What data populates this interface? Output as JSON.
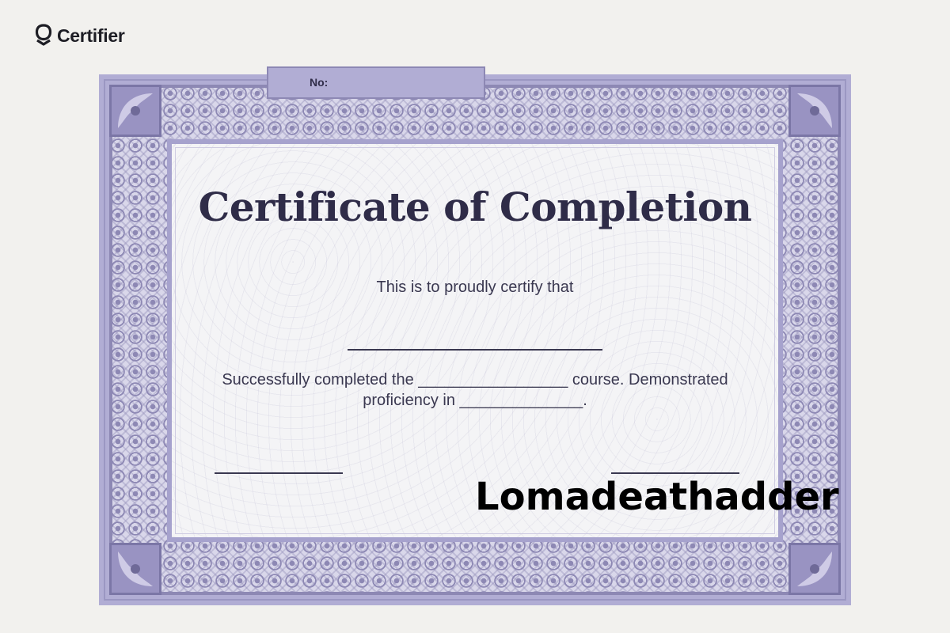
{
  "brand": {
    "name": "Certifier",
    "icon": "shield-check-icon"
  },
  "certificate": {
    "number_label": "No:",
    "title": "Certificate of Completion",
    "intro": "This is to proudly certify that",
    "body_line1": "Successfully completed the _________________ course. Demonstrated",
    "body_line2": "proficiency in ______________."
  },
  "overlay_text": "Lomadeathadder",
  "colors": {
    "frame": "#b1add4",
    "frame_dark": "#8d88b4",
    "panel": "#f4f4f6",
    "text": "#2f2c48",
    "page_bg": "#f2f1ee"
  }
}
